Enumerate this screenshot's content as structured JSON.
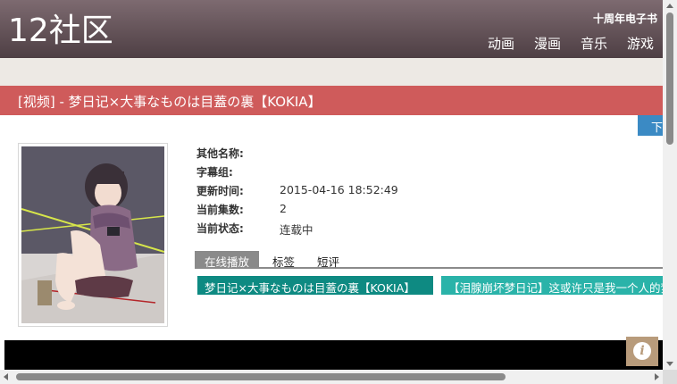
{
  "header": {
    "logo": "12社区",
    "ebook_link": "十周年电子书",
    "nav": [
      "动画",
      "漫画",
      "音乐",
      "游戏"
    ]
  },
  "title": "[视频] - 梦日记×大事なものは目蓋の裏【KOKIA】",
  "download_label": "下载",
  "info": {
    "rows": [
      {
        "label": "其他名称:",
        "value": ""
      },
      {
        "label": "字幕组:",
        "value": ""
      },
      {
        "label": "更新时间:",
        "value": "2015-04-16 18:52:49"
      },
      {
        "label": "当前集数:",
        "value": "2"
      },
      {
        "label": "当前状态:",
        "value": "连载中"
      }
    ]
  },
  "tabs": [
    "在线播放",
    "标签",
    "短评"
  ],
  "episodes": [
    "梦日记×大事なものは目蓋の裏【KOKIA】",
    "【泪腺崩坏梦日记】这或许只是我一个人的梦"
  ],
  "info_badge_glyph": "i",
  "colors": {
    "header_top": "#7d6a70",
    "header_bottom": "#4e3f44",
    "title_bar": "#cf5b5b",
    "download": "#3b8ac4",
    "episode_primary": "#0e8a82",
    "episode_secondary": "#2ab3a9",
    "info_badge": "#b89b7b"
  }
}
